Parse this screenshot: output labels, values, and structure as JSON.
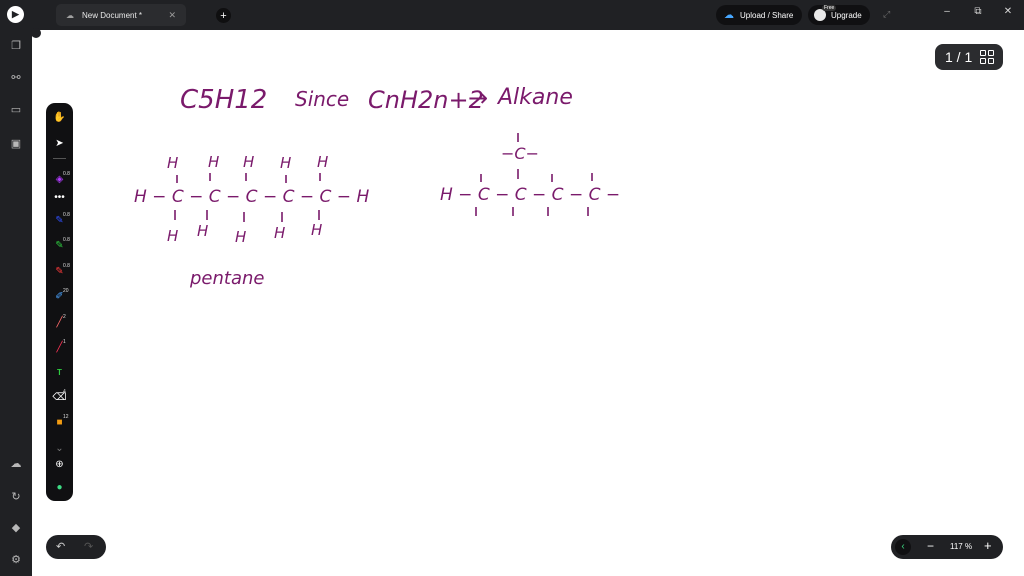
{
  "window": {
    "tab_title": "New Document *",
    "tab_icon": "cloud-off-icon",
    "new_tab": "+",
    "upload_label": "Upload / Share",
    "upgrade_label": "Upgrade",
    "free_badge": "Free",
    "win_minimize": "–",
    "win_restore": "⧉",
    "win_close": "✕"
  },
  "page_indicator": "1 / 1",
  "zoom": {
    "value": "117 %",
    "minus": "−",
    "plus": "+"
  },
  "toolbar": {
    "tools": [
      {
        "name": "hand-tool",
        "num": ""
      },
      {
        "name": "select-tool",
        "num": ""
      },
      {
        "name": "lasso-tool",
        "num": "0.8"
      },
      {
        "name": "more-tool",
        "num": ""
      },
      {
        "name": "pen-blue-tool",
        "num": "0.8"
      },
      {
        "name": "pen-green-tool",
        "num": "0.8"
      },
      {
        "name": "pen-red-tool",
        "num": "0.8"
      },
      {
        "name": "brush-tool",
        "num": "20"
      },
      {
        "name": "line-tool",
        "num": "2"
      },
      {
        "name": "laser-tool",
        "num": "1"
      },
      {
        "name": "text-tool",
        "num": ""
      },
      {
        "name": "eraser-tool",
        "num": "4"
      },
      {
        "name": "shapes-tool",
        "num": "12"
      }
    ],
    "stroke_width": "0.8",
    "brush_size": "20",
    "line_size": "2",
    "laser_size": "1",
    "eraser_size": "4",
    "shape_size": "12",
    "text_tool_label": "T"
  },
  "colors": {
    "ink": "#7a1a6b",
    "canvas": "#ffffff",
    "chrome": "#202124",
    "accent_green": "#3ddc84",
    "accent_blue": "#47a7ff"
  },
  "handwriting": {
    "formula": "C5H12",
    "since": "Since",
    "general": "CnH2n+2",
    "arrow": "→",
    "alkane": "Alkane",
    "pentane_label": "pentane",
    "top_h_row": [
      "H",
      "H",
      "H",
      "H",
      "H"
    ],
    "main_chain": "H − C − C − C − C − C − H",
    "bottom_h_row": [
      "H",
      "H",
      "H",
      "H",
      "H"
    ],
    "branch_top": "−C−",
    "branch_chain": "H − C − C − C − C −"
  }
}
